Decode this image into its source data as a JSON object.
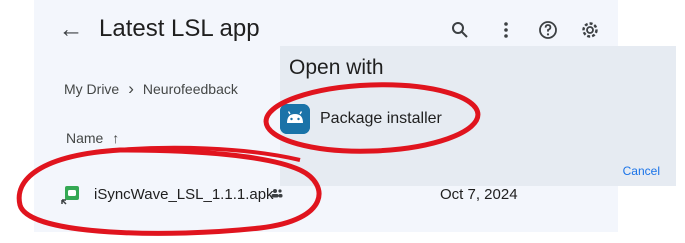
{
  "header": {
    "title": "Latest LSL app",
    "back_icon": "arrow-back-icon",
    "icons": [
      "search-icon",
      "more-vert-icon",
      "help-icon",
      "settings-icon"
    ]
  },
  "breadcrumb": {
    "items": [
      "My Drive",
      "Neurofeedback"
    ]
  },
  "list": {
    "column_name": "Name",
    "sort_icon": "arrow-up-icon",
    "rows": [
      {
        "name": "iSyncWave_LSL_1.1.1.apk",
        "date": "Oct 7, 2024",
        "icon": "apk-file-icon",
        "shared_icon": "shared-people-icon"
      }
    ]
  },
  "dialog": {
    "title": "Open with",
    "options": [
      {
        "label": "Package installer",
        "icon": "android-icon"
      }
    ],
    "cancel_label": "Cancel"
  },
  "colors": {
    "annotation": "#e0141e",
    "accent": "#1a73e8",
    "app_icon_bg": "#1a73a8",
    "panel_bg": "#f3f6fc",
    "dialog_bg": "#e6ebf2"
  }
}
